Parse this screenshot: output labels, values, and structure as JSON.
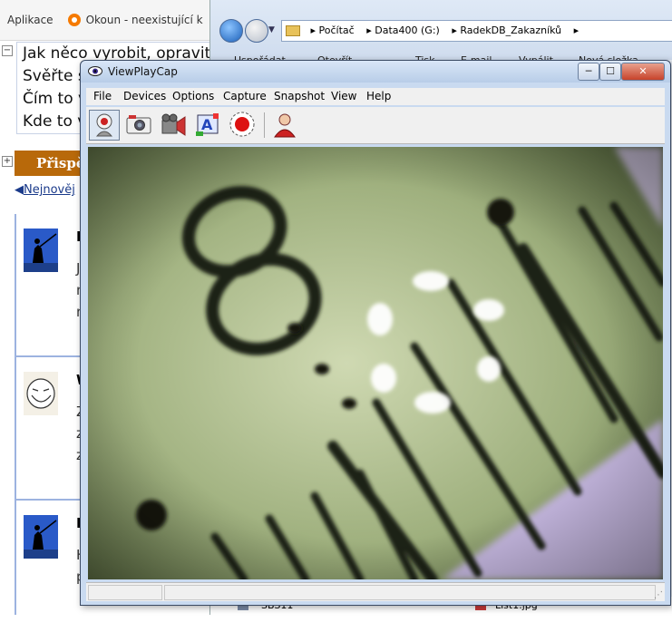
{
  "browser": {
    "bookmarks": [
      {
        "label": "Aplikace"
      },
      {
        "label": "Okoun - neexistující k"
      }
    ],
    "intro_lines": [
      "Jak něco vyrobit, opravit",
      "Svěřte s",
      "Čím to v",
      "Kde to v"
    ],
    "post_button_label": "Přispě",
    "nav_newer_label": "Nejnověj",
    "posts": [
      {
        "title": "H",
        "body": [
          "J",
          "n",
          "n"
        ]
      },
      {
        "title": "W",
        "body": [
          "Z",
          "z",
          "z"
        ]
      },
      {
        "title": "H",
        "body": [
          "H",
          "p"
        ]
      }
    ]
  },
  "explorer": {
    "breadcrumb": [
      "Počítač",
      "Data400 (G:)",
      "RadekDB_Zakazníků"
    ],
    "toolbar": [
      "Uspořádat",
      "Otevřít",
      "Tisk",
      "E-mail",
      "Vypálit",
      "Nová složka"
    ],
    "files": [
      "SBS11",
      "List1.jpg"
    ]
  },
  "viewplaycap": {
    "title": "ViewPlayCap",
    "menu": [
      "File",
      "Devices",
      "Options",
      "Capture",
      "Snapshot",
      "View",
      "Help"
    ],
    "toolbar_icons": [
      "webcam-icon",
      "camera-icon",
      "video-camera-icon",
      "color-adjust-icon",
      "record-icon",
      "person-icon"
    ],
    "window_buttons": {
      "minimize": "─",
      "maximize": "☐",
      "close": "✕"
    },
    "video_digit": "8"
  }
}
